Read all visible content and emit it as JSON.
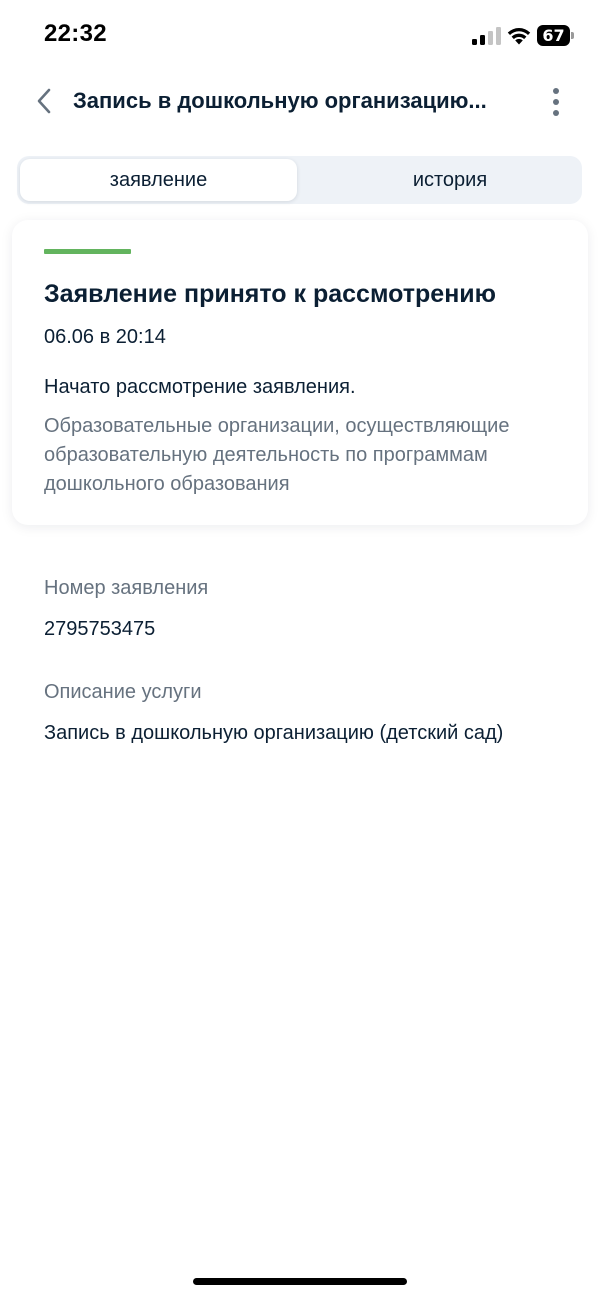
{
  "status_bar": {
    "time": "22:32",
    "battery": "67",
    "icons": [
      "signal-icon",
      "wifi-icon",
      "battery-icon"
    ]
  },
  "header": {
    "title": "Запись в дошкольную организацию...",
    "back_icon": "chevron-left-icon",
    "more_icon": "more-vertical-icon"
  },
  "tabs": [
    {
      "label": "заявление",
      "active": true
    },
    {
      "label": "история",
      "active": false
    }
  ],
  "status_card": {
    "accent_color": "#63b45e",
    "title": "Заявление принято к рассмотрению",
    "date": "06.06 в 20:14",
    "message": "Начато рассмотрение заявления.",
    "organization": "Образовательные организации, осуществляющие образовательную деятельность по программам дошкольного образования"
  },
  "details": {
    "application_number_label": "Номер заявления",
    "application_number": "2795753475",
    "service_description_label": "Описание услуги",
    "service_description": "Запись в дошкольную организацию (детский сад)"
  }
}
